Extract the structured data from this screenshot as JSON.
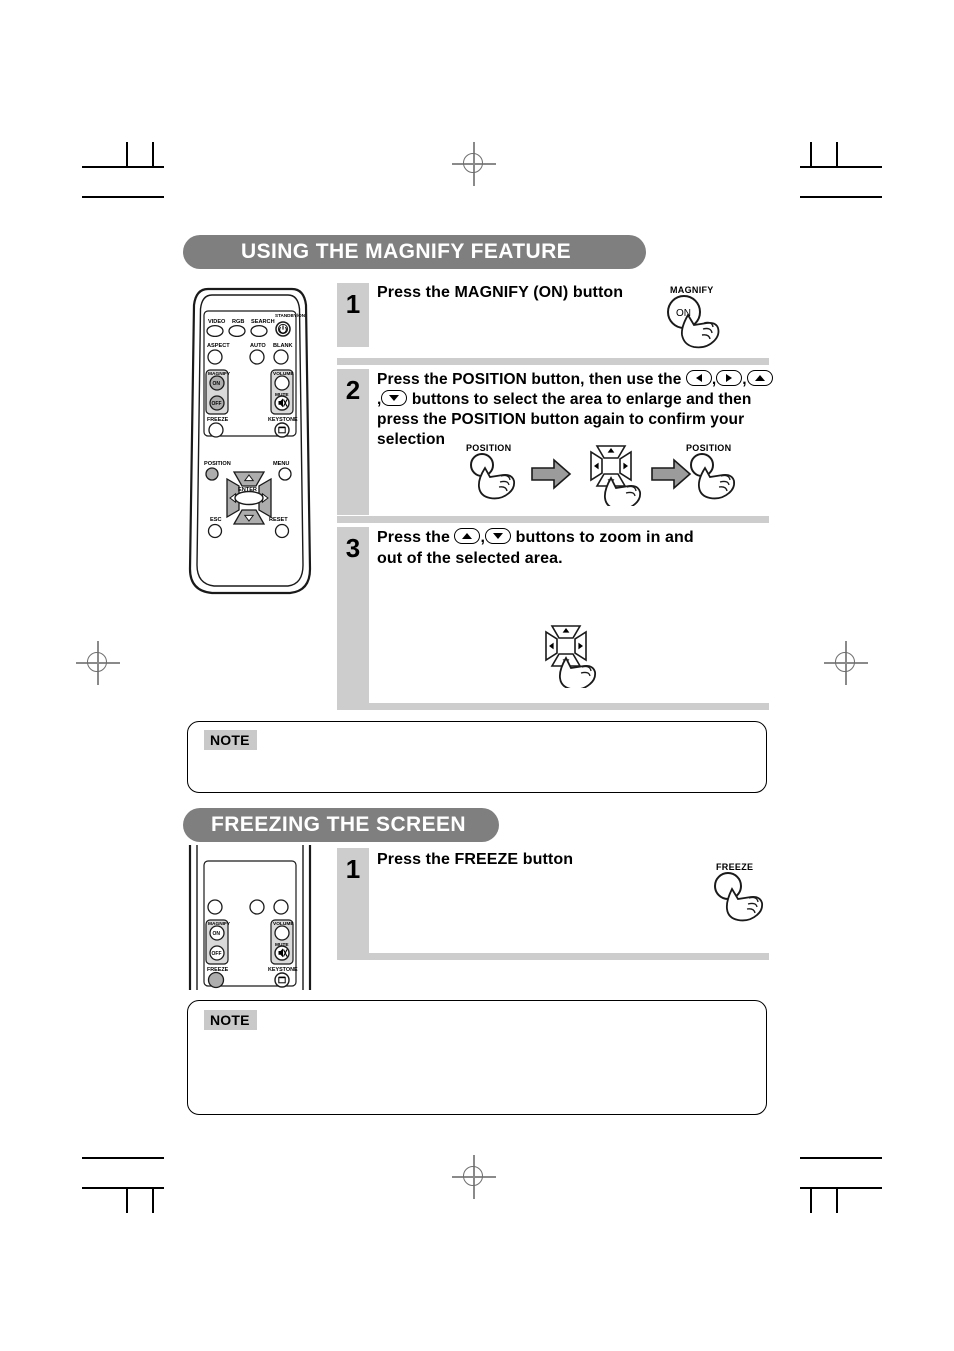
{
  "sections": [
    {
      "id": "magnify",
      "title": "USING THE MAGNIFY FEATURE"
    },
    {
      "id": "freeze",
      "title": "FREEZING THE SCREEN"
    }
  ],
  "magnify_steps": [
    {
      "number": "1",
      "text_parts": [
        "Press the MAGNIFY (ON) button"
      ],
      "text_plain": "Press the MAGNIFY (ON) button"
    },
    {
      "number": "2",
      "line1_a": "Press the POSITION button, then use the ",
      "line2_a": " buttons to select the area to enlarge and then",
      "line3": "press the POSITION button again to confirm your",
      "line4": "selection"
    },
    {
      "number": "3",
      "line1_a": "Press the ",
      "line1_b": " buttons to zoom in and",
      "line2": "out of the selected area."
    }
  ],
  "freeze_steps": [
    {
      "number": "1",
      "text_plain": "Press the FREEZE button"
    }
  ],
  "callouts": {
    "magnify_label": "MAGNIFY",
    "magnify_button": "ON",
    "position_label_1": "POSITION",
    "position_label_2": "POSITION",
    "freeze_label": "FREEZE"
  },
  "notes": [
    {
      "label": "NOTE",
      "body": ""
    },
    {
      "label": "NOTE",
      "body": ""
    }
  ],
  "remote_labels": {
    "video": "VIDEO",
    "rgb": "RGB",
    "search": "SEARCH",
    "standby_on": "STANDBY/ON",
    "aspect": "ASPECT",
    "auto": "AUTO",
    "blank": "BLANK",
    "magnify": "MAGNIFY",
    "magnify_on": "ON",
    "magnify_off": "OFF",
    "volume": "VOLUME",
    "mute": "MUTE",
    "freeze": "FREEZE",
    "keystone": "KEYSTONE",
    "position": "POSITION",
    "menu": "MENU",
    "enter": "ENTER",
    "esc": "ESC",
    "reset": "RESET"
  },
  "colors": {
    "heading_bar": "#807f7f",
    "step_number_bg": "#cdcdcd",
    "note_label_bg": "#c9c9c9",
    "page_bg": "#ffffff",
    "ink": "#000000"
  }
}
